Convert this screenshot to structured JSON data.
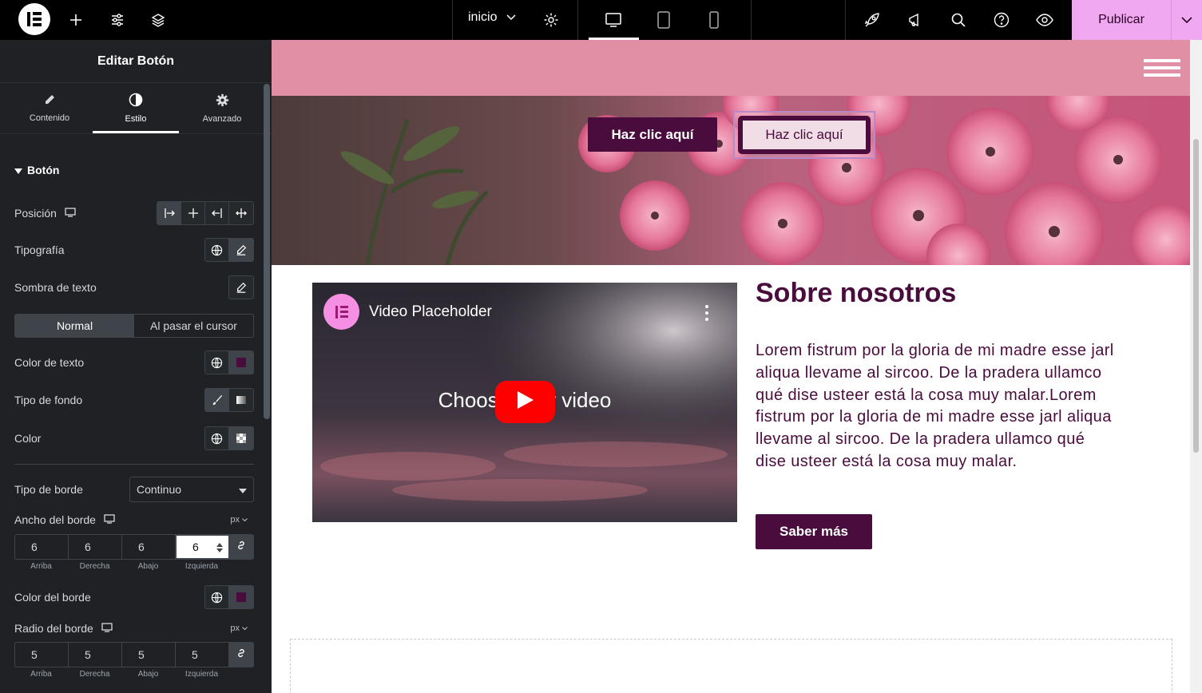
{
  "topbar": {
    "page_name": "inicio",
    "publish_label": "Publicar",
    "icons": [
      "elementor-logo-icon",
      "add-icon",
      "settings-sliders-icon",
      "layers-icon",
      "chevron-down-icon",
      "gear-icon",
      "desktop-icon",
      "tablet-icon",
      "mobile-icon",
      "rocket-icon",
      "megaphone-icon",
      "search-icon",
      "help-icon",
      "eye-icon"
    ]
  },
  "panel": {
    "title": "Editar Botón",
    "tabs": [
      {
        "label": "Contenido",
        "icon": "pencil-icon"
      },
      {
        "label": "Estilo",
        "icon": "contrast-icon"
      },
      {
        "label": "Avanzado",
        "icon": "gear-icon"
      }
    ],
    "section": "Botón",
    "rows": {
      "position": "Posición",
      "typography": "Tipografía",
      "text_shadow": "Sombra de texto",
      "text_color": "Color de texto",
      "bg_type": "Tipo de fondo",
      "color": "Color",
      "border_type": "Tipo de borde",
      "border_width": "Ancho del borde",
      "border_color": "Color del borde",
      "border_radius": "Radio del borde"
    },
    "state_tabs": {
      "normal": "Normal",
      "hover": "Al pasar el cursor"
    },
    "border_type_value": "Continuo",
    "unit": "px",
    "border_width_values": [
      "6",
      "6",
      "6",
      "6"
    ],
    "border_radius_values": [
      "5",
      "5",
      "5",
      "5"
    ],
    "dim_labels": [
      "Arriba",
      "Derecha",
      "Abajo",
      "Izquierda"
    ],
    "colors": {
      "text_color": "#4a0c3d",
      "border_color": "#4a0c3d"
    }
  },
  "canvas": {
    "btn_primary": "Haz clic aquí",
    "btn_outline": "Haz clic aquí",
    "video_title": "Video Placeholder",
    "video_text": "Choose your video",
    "about_title": "Sobre nosotros",
    "about_text": "Lorem fistrum por la gloria de mi madre esse jarl aliqua llevame al sircoo. De la pradera ullamco qué dise usteer está la cosa muy malar.Lorem fistrum por la gloria de mi madre esse jarl aliqua llevame al sircoo. De la pradera ullamco qué dise usteer está la cosa muy malar.",
    "more_button": "Saber más",
    "accent": "#4a0c3d",
    "header_color": "#e18fa5"
  }
}
